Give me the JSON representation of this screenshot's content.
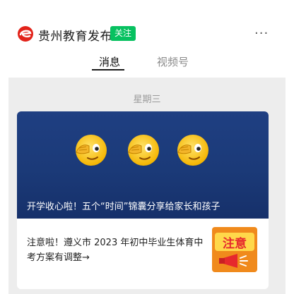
{
  "account": {
    "name": "贵州教育发布",
    "follow_label": "关注",
    "more_icon": "more-dots-icon"
  },
  "tabs": [
    {
      "label": "消息",
      "active": true
    },
    {
      "label": "视频号",
      "active": false
    }
  ],
  "feed": {
    "day_label": "星期三",
    "card": {
      "headline": "开学收心啦！五个“时间”锦囊分享给家长和孩子",
      "cover_icons": [
        "facepalm-emoji-icon",
        "facepalm-emoji-icon",
        "facepalm-emoji-icon"
      ],
      "sub_article": {
        "title": "注意啦！遵义市 2023 年初中毕业生体育中考方案有调整→",
        "thumb_text": "注意"
      }
    }
  },
  "colors": {
    "follow_badge": "#07c160",
    "cover_bg": "#1b3a78",
    "thumb_bg": "#f08a1c",
    "thumb_text": "#e6282d"
  }
}
